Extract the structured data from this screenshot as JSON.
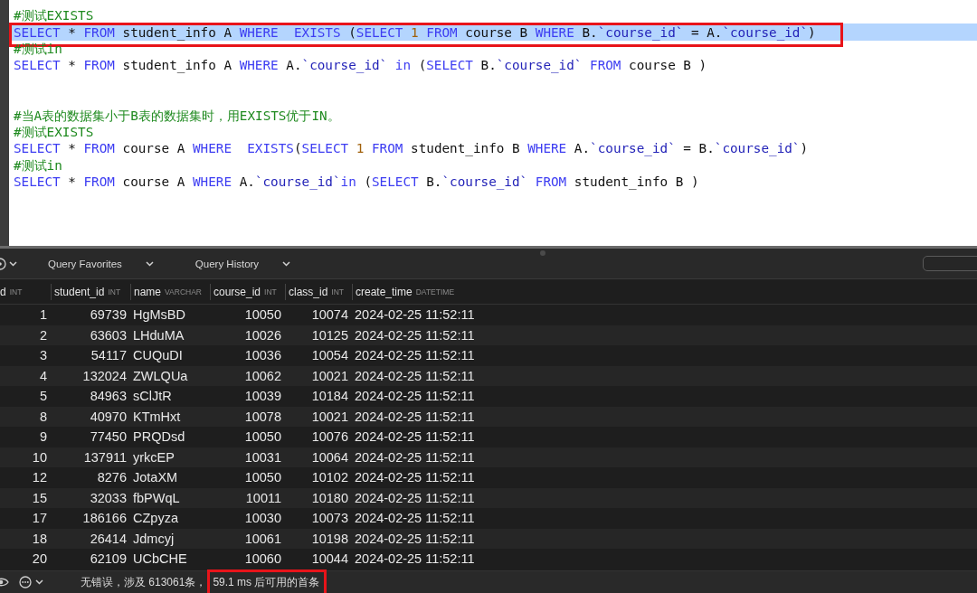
{
  "editor": {
    "lines": [
      {
        "kind": "code",
        "highlighted": false,
        "annotated": false,
        "tokens": [
          {
            "kind": "comment",
            "text": "#测试EXISTS"
          }
        ]
      },
      {
        "kind": "code",
        "highlighted": true,
        "annotated": true,
        "tokens": [
          {
            "kind": "keyword",
            "text": "SELECT"
          },
          {
            "kind": "plain",
            "text": " * "
          },
          {
            "kind": "keyword",
            "text": "FROM"
          },
          {
            "kind": "plain",
            "text": " student_info A "
          },
          {
            "kind": "keyword",
            "text": "WHERE"
          },
          {
            "kind": "keyword",
            "text": "  EXISTS"
          },
          {
            "kind": "plain",
            "text": " ("
          },
          {
            "kind": "keyword",
            "text": "SELECT"
          },
          {
            "kind": "number",
            "text": " 1"
          },
          {
            "kind": "keyword",
            "text": " FROM"
          },
          {
            "kind": "plain",
            "text": " course B "
          },
          {
            "kind": "keyword",
            "text": "WHERE"
          },
          {
            "kind": "plain",
            "text": " B."
          },
          {
            "kind": "ident",
            "text": "`course_id`"
          },
          {
            "kind": "plain",
            "text": " = A."
          },
          {
            "kind": "ident",
            "text": "`course_id`"
          },
          {
            "kind": "plain",
            "text": ")"
          }
        ]
      },
      {
        "kind": "code",
        "highlighted": false,
        "annotated": false,
        "tokens": [
          {
            "kind": "comment",
            "text": "#测试in"
          }
        ]
      },
      {
        "kind": "code",
        "highlighted": false,
        "annotated": false,
        "tokens": [
          {
            "kind": "keyword",
            "text": "SELECT"
          },
          {
            "kind": "plain",
            "text": " * "
          },
          {
            "kind": "keyword",
            "text": "FROM"
          },
          {
            "kind": "plain",
            "text": " student_info A "
          },
          {
            "kind": "keyword",
            "text": "WHERE"
          },
          {
            "kind": "plain",
            "text": " A."
          },
          {
            "kind": "ident",
            "text": "`course_id`"
          },
          {
            "kind": "keyword",
            "text": " in"
          },
          {
            "kind": "plain",
            "text": " ("
          },
          {
            "kind": "keyword",
            "text": "SELECT"
          },
          {
            "kind": "plain",
            "text": " B."
          },
          {
            "kind": "ident",
            "text": "`course_id`"
          },
          {
            "kind": "keyword",
            "text": " FROM"
          },
          {
            "kind": "plain",
            "text": " course B )"
          }
        ]
      },
      {
        "kind": "blank"
      },
      {
        "kind": "blank"
      },
      {
        "kind": "code",
        "highlighted": false,
        "annotated": false,
        "tokens": [
          {
            "kind": "comment",
            "text": "#当A表的数据集小于B表的数据集时，用EXISTS优于IN。"
          }
        ]
      },
      {
        "kind": "code",
        "highlighted": false,
        "annotated": false,
        "tokens": [
          {
            "kind": "comment",
            "text": "#测试EXISTS"
          }
        ]
      },
      {
        "kind": "code",
        "highlighted": false,
        "annotated": false,
        "tokens": [
          {
            "kind": "keyword",
            "text": "SELECT"
          },
          {
            "kind": "plain",
            "text": " * "
          },
          {
            "kind": "keyword",
            "text": "FROM"
          },
          {
            "kind": "plain",
            "text": " course A "
          },
          {
            "kind": "keyword",
            "text": "WHERE"
          },
          {
            "kind": "keyword",
            "text": "  EXISTS"
          },
          {
            "kind": "plain",
            "text": "("
          },
          {
            "kind": "keyword",
            "text": "SELECT"
          },
          {
            "kind": "number",
            "text": " 1"
          },
          {
            "kind": "keyword",
            "text": " FROM"
          },
          {
            "kind": "plain",
            "text": " student_info B "
          },
          {
            "kind": "keyword",
            "text": "WHERE"
          },
          {
            "kind": "plain",
            "text": " A."
          },
          {
            "kind": "ident",
            "text": "`course_id`"
          },
          {
            "kind": "plain",
            "text": " = B."
          },
          {
            "kind": "ident",
            "text": "`course_id`"
          },
          {
            "kind": "plain",
            "text": ")"
          }
        ]
      },
      {
        "kind": "code",
        "highlighted": false,
        "annotated": false,
        "tokens": [
          {
            "kind": "comment",
            "text": "#测试in"
          }
        ]
      },
      {
        "kind": "code",
        "highlighted": false,
        "annotated": false,
        "tokens": [
          {
            "kind": "keyword",
            "text": "SELECT"
          },
          {
            "kind": "plain",
            "text": " * "
          },
          {
            "kind": "keyword",
            "text": "FROM"
          },
          {
            "kind": "plain",
            "text": " course A "
          },
          {
            "kind": "keyword",
            "text": "WHERE"
          },
          {
            "kind": "plain",
            "text": " A."
          },
          {
            "kind": "ident",
            "text": "`course_id`"
          },
          {
            "kind": "keyword",
            "text": "in"
          },
          {
            "kind": "plain",
            "text": " ("
          },
          {
            "kind": "keyword",
            "text": "SELECT"
          },
          {
            "kind": "plain",
            "text": " B."
          },
          {
            "kind": "ident",
            "text": "`course_id`"
          },
          {
            "kind": "keyword",
            "text": " FROM"
          },
          {
            "kind": "plain",
            "text": " student_info B )"
          }
        ]
      }
    ]
  },
  "toolbar": {
    "menus": [
      {
        "label": "Query Favorites"
      },
      {
        "label": "Query History"
      }
    ]
  },
  "table": {
    "columns": [
      {
        "label": "d",
        "type": "INT"
      },
      {
        "label": "student_id",
        "type": "INT"
      },
      {
        "label": "name",
        "type": "VARCHAR"
      },
      {
        "label": "course_id",
        "type": "INT"
      },
      {
        "label": "class_id",
        "type": "INT"
      },
      {
        "label": "create_time",
        "type": "DATETIME"
      }
    ],
    "rows": [
      [
        "1",
        "69739",
        "HgMsBD",
        "10050",
        "10074",
        "2024-02-25 11:52:11"
      ],
      [
        "2",
        "63603",
        "LHduMA",
        "10026",
        "10125",
        "2024-02-25 11:52:11"
      ],
      [
        "3",
        "54117",
        "CUQuDI",
        "10036",
        "10054",
        "2024-02-25 11:52:11"
      ],
      [
        "4",
        "132024",
        "ZWLQUa",
        "10062",
        "10021",
        "2024-02-25 11:52:11"
      ],
      [
        "5",
        "84963",
        "sClJtR",
        "10039",
        "10184",
        "2024-02-25 11:52:11"
      ],
      [
        "8",
        "40970",
        "KTmHxt",
        "10078",
        "10021",
        "2024-02-25 11:52:11"
      ],
      [
        "9",
        "77450",
        "PRQDsd",
        "10050",
        "10076",
        "2024-02-25 11:52:11"
      ],
      [
        "10",
        "137911",
        "yrkcEP",
        "10031",
        "10064",
        "2024-02-25 11:52:11"
      ],
      [
        "12",
        "8276",
        "JotaXM",
        "10050",
        "10102",
        "2024-02-25 11:52:11"
      ],
      [
        "15",
        "32033",
        "fbPWqL",
        "10011",
        "10180",
        "2024-02-25 11:52:11"
      ],
      [
        "17",
        "186166",
        "CZpyza",
        "10030",
        "10073",
        "2024-02-25 11:52:11"
      ],
      [
        "18",
        "26414",
        "Jdmcyj",
        "10061",
        "10198",
        "2024-02-25 11:52:11"
      ],
      [
        "20",
        "62109",
        "UCbCHE",
        "10060",
        "10044",
        "2024-02-25 11:52:11"
      ]
    ]
  },
  "status_bar": {
    "parts": [
      {
        "text": "无错误，涉及 613061条，",
        "annotated": false
      },
      {
        "text": "59.1 ms 后可用的首条",
        "annotated": true
      }
    ]
  }
}
